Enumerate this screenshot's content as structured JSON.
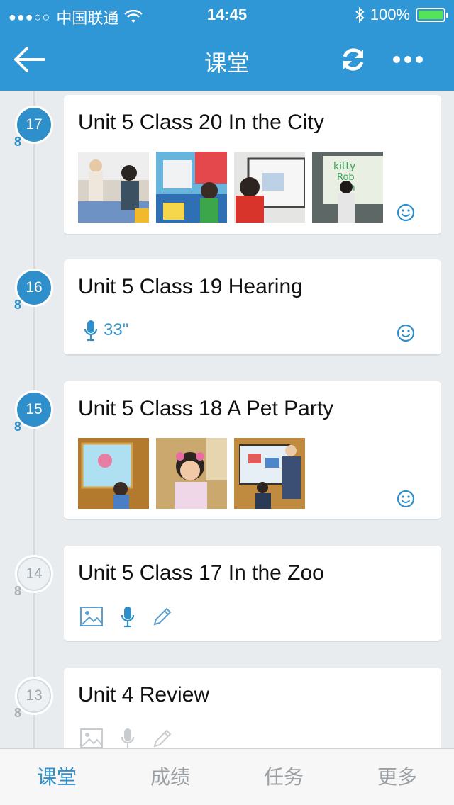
{
  "status_bar": {
    "carrier": "中国联通",
    "time": "14:45",
    "battery": "100%",
    "signal_dots": "●●●○○"
  },
  "nav": {
    "title": "课堂",
    "back_icon": "back-arrow-icon",
    "refresh_icon": "refresh-icon",
    "more_icon": "more-icon"
  },
  "entries": [
    {
      "num": "17",
      "sub": "8",
      "title": "Unit 5 Class 20 In the City",
      "state": "active"
    },
    {
      "num": "16",
      "sub": "8",
      "title": "Unit 5 Class 19 Hearing",
      "state": "active",
      "audio": "33\""
    },
    {
      "num": "15",
      "sub": "8",
      "title": "Unit 5 Class 18 A Pet Party",
      "state": "active"
    },
    {
      "num": "14",
      "sub": "8",
      "title": "Unit 5 Class 17 In the Zoo",
      "state": "inactive"
    },
    {
      "num": "13",
      "sub": "8",
      "title": "Unit 4 Review",
      "state": "inactive"
    }
  ],
  "tabs": [
    {
      "label": "课堂"
    },
    {
      "label": "成绩"
    },
    {
      "label": "任务"
    },
    {
      "label": "更多"
    }
  ],
  "colors": {
    "accent": "#2f97d6",
    "active_badge": "#2f8fca",
    "inactive_text": "#9aa3aa"
  }
}
